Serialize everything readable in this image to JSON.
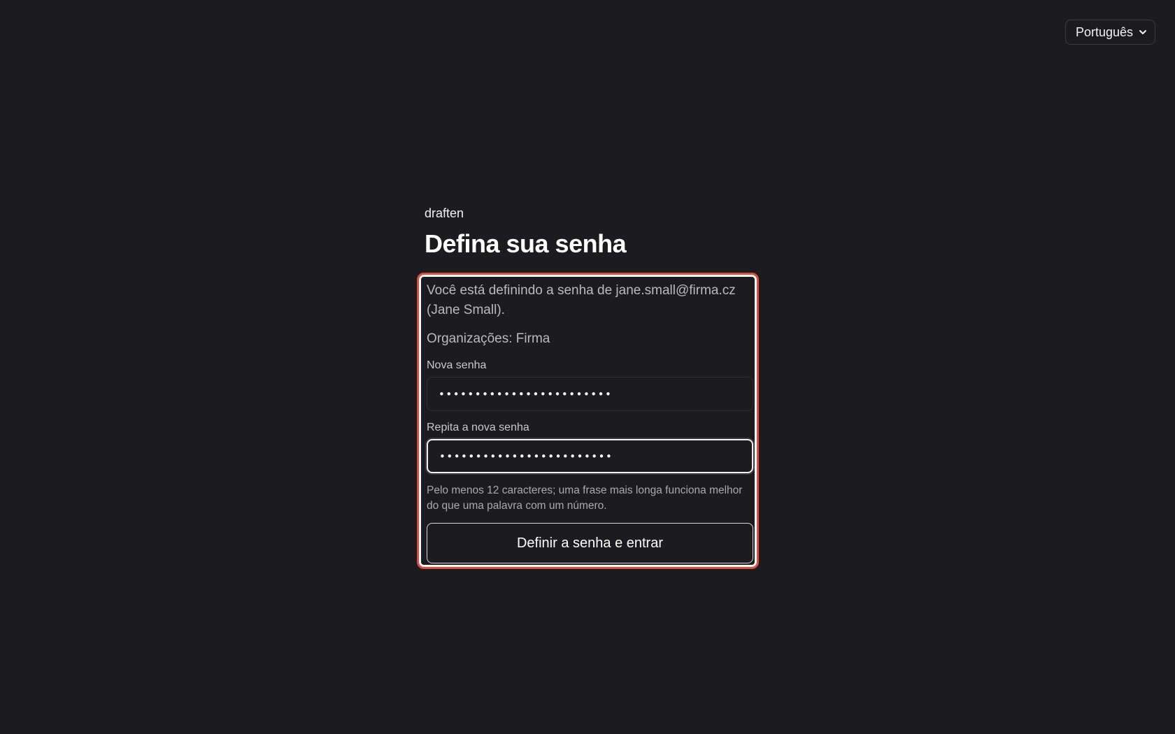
{
  "language": {
    "selected": "Português"
  },
  "brand": "draften",
  "title": "Defina sua senha",
  "intro": "Você está definindo a senha de jane.small@firma.cz (Jane Small).",
  "organizations": "Organizações: Firma",
  "fields": {
    "new_password": {
      "label": "Nova senha",
      "value": "••••••••••••••••••••••••"
    },
    "repeat_password": {
      "label": "Repita a nova senha",
      "value": "••••••••••••••••••••••••"
    }
  },
  "hint": "Pelo menos 12 caracteres; uma frase mais longa funciona melhor do que uma palavra com um número.",
  "submit_label": "Definir a senha e entrar",
  "colors": {
    "background": "#1c1c20",
    "highlight_border": "#e24b37"
  }
}
